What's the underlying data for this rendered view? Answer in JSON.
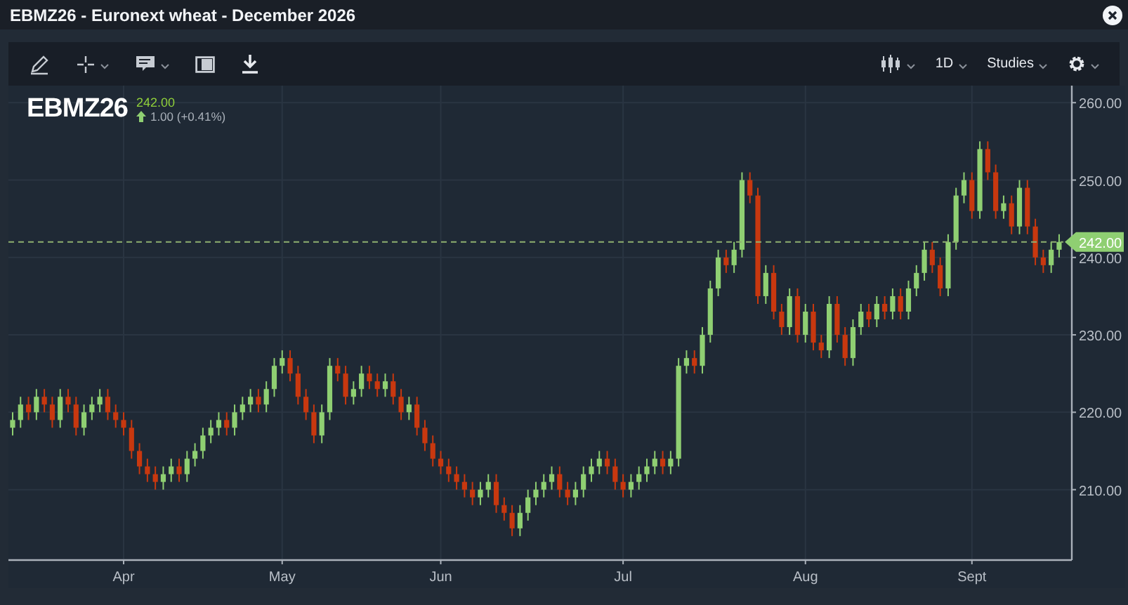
{
  "window": {
    "title": "EBMZ26 - Euronext wheat - December 2026"
  },
  "toolbar": {
    "interval": "1D",
    "studies": "Studies"
  },
  "quote": {
    "symbol": "EBMZ26",
    "price": "242.00",
    "change": "1.00 (+0.41%)"
  },
  "chart_data": {
    "type": "candlestick",
    "grid": true,
    "ylim": [
      200.9,
      262.2
    ],
    "yticks": [
      {
        "value": 210,
        "label": "210.00"
      },
      {
        "value": 220,
        "label": "220.00"
      },
      {
        "value": 230,
        "label": "230.00"
      },
      {
        "value": 240,
        "label": "240.00"
      },
      {
        "value": 250,
        "label": "250.00"
      },
      {
        "value": 260,
        "label": "260.00"
      }
    ],
    "ref_lines": [
      {
        "axis": "y",
        "value": 242,
        "label": "242.00",
        "color": "#8fb070"
      }
    ],
    "categories": [
      null,
      null,
      null,
      null,
      null,
      null,
      null,
      null,
      null,
      null,
      null,
      null,
      null,
      null,
      "Apr",
      null,
      null,
      null,
      null,
      null,
      null,
      null,
      null,
      null,
      null,
      null,
      null,
      null,
      null,
      null,
      null,
      null,
      null,
      null,
      "May",
      null,
      null,
      null,
      null,
      null,
      null,
      null,
      null,
      null,
      null,
      null,
      null,
      null,
      null,
      null,
      null,
      null,
      null,
      null,
      "Jun",
      null,
      null,
      null,
      null,
      null,
      null,
      null,
      null,
      null,
      null,
      null,
      null,
      null,
      null,
      null,
      null,
      null,
      null,
      null,
      null,
      null,
      null,
      "Jul",
      null,
      null,
      null,
      null,
      null,
      null,
      null,
      null,
      null,
      null,
      null,
      null,
      null,
      null,
      null,
      null,
      null,
      null,
      null,
      null,
      null,
      null,
      "Aug",
      null,
      null,
      null,
      null,
      null,
      null,
      null,
      null,
      null,
      null,
      null,
      null,
      null,
      null,
      null,
      null,
      null,
      null,
      null,
      null,
      "Sept",
      null,
      null,
      null,
      null,
      null,
      null,
      null,
      null,
      null,
      null,
      null
    ],
    "ohlc": [
      [
        218,
        220,
        217,
        219
      ],
      [
        219,
        222,
        218,
        221
      ],
      [
        221,
        222,
        219,
        220
      ],
      [
        220,
        223,
        219,
        222
      ],
      [
        222,
        223,
        220,
        221
      ],
      [
        221,
        222,
        218,
        219
      ],
      [
        219,
        223,
        218,
        222
      ],
      [
        222,
        223,
        220,
        221
      ],
      [
        221,
        222,
        217,
        218
      ],
      [
        218,
        221,
        217,
        220
      ],
      [
        220,
        222,
        219,
        221
      ],
      [
        221,
        223,
        220,
        222
      ],
      [
        222,
        223,
        219,
        220
      ],
      [
        220,
        221,
        218,
        219
      ],
      [
        219,
        220,
        217,
        218
      ],
      [
        218,
        219,
        214,
        215
      ],
      [
        215,
        216,
        212,
        213
      ],
      [
        213,
        214,
        211,
        212
      ],
      [
        212,
        213,
        210,
        211
      ],
      [
        211,
        213,
        210,
        212
      ],
      [
        212,
        214,
        211,
        213
      ],
      [
        213,
        214,
        211,
        212
      ],
      [
        212,
        215,
        211,
        214
      ],
      [
        214,
        216,
        213,
        215
      ],
      [
        215,
        218,
        214,
        217
      ],
      [
        217,
        219,
        216,
        218
      ],
      [
        218,
        220,
        217,
        219
      ],
      [
        219,
        220,
        217,
        218
      ],
      [
        218,
        221,
        217,
        220
      ],
      [
        220,
        222,
        219,
        221
      ],
      [
        221,
        223,
        220,
        222
      ],
      [
        222,
        223,
        220,
        221
      ],
      [
        221,
        224,
        220,
        223
      ],
      [
        223,
        227,
        222,
        226
      ],
      [
        226,
        228,
        225,
        227
      ],
      [
        227,
        228,
        224,
        225
      ],
      [
        225,
        226,
        221,
        222
      ],
      [
        222,
        223,
        219,
        220
      ],
      [
        220,
        221,
        216,
        217
      ],
      [
        217,
        221,
        216,
        220
      ],
      [
        220,
        227,
        219,
        226
      ],
      [
        226,
        227,
        224,
        225
      ],
      [
        225,
        226,
        221,
        222
      ],
      [
        222,
        224,
        221,
        223
      ],
      [
        223,
        226,
        222,
        225
      ],
      [
        225,
        226,
        223,
        224
      ],
      [
        224,
        225,
        222,
        223
      ],
      [
        223,
        225,
        222,
        224
      ],
      [
        224,
        225,
        221,
        222
      ],
      [
        222,
        223,
        219,
        220
      ],
      [
        220,
        222,
        219,
        221
      ],
      [
        221,
        222,
        217,
        218
      ],
      [
        218,
        219,
        215,
        216
      ],
      [
        216,
        217,
        213,
        214
      ],
      [
        214,
        215,
        212,
        213
      ],
      [
        213,
        214,
        211,
        212
      ],
      [
        212,
        213,
        210,
        211
      ],
      [
        211,
        212,
        209,
        210
      ],
      [
        210,
        211,
        208,
        209
      ],
      [
        209,
        211,
        208,
        210
      ],
      [
        210,
        212,
        209,
        211
      ],
      [
        211,
        212,
        207,
        208
      ],
      [
        208,
        209,
        206,
        207
      ],
      [
        207,
        208,
        204,
        205
      ],
      [
        205,
        208,
        204,
        207
      ],
      [
        207,
        210,
        206,
        209
      ],
      [
        209,
        211,
        208,
        210
      ],
      [
        210,
        212,
        209,
        211
      ],
      [
        211,
        213,
        210,
        212
      ],
      [
        212,
        213,
        209,
        210
      ],
      [
        210,
        211,
        208,
        209
      ],
      [
        209,
        211,
        208,
        210
      ],
      [
        210,
        213,
        209,
        212
      ],
      [
        212,
        214,
        211,
        213
      ],
      [
        213,
        215,
        212,
        214
      ],
      [
        214,
        215,
        212,
        213
      ],
      [
        213,
        214,
        210,
        211
      ],
      [
        211,
        212,
        209,
        210
      ],
      [
        210,
        212,
        209,
        211
      ],
      [
        211,
        213,
        210,
        212
      ],
      [
        212,
        214,
        211,
        213
      ],
      [
        213,
        215,
        212,
        214
      ],
      [
        214,
        215,
        212,
        213
      ],
      [
        213,
        215,
        212,
        214
      ],
      [
        214,
        227,
        213,
        226
      ],
      [
        226,
        228,
        225,
        227
      ],
      [
        227,
        228,
        225,
        226
      ],
      [
        226,
        231,
        225,
        230
      ],
      [
        230,
        237,
        229,
        236
      ],
      [
        236,
        241,
        235,
        240
      ],
      [
        240,
        241,
        238,
        239
      ],
      [
        239,
        242,
        238,
        241
      ],
      [
        241,
        251,
        240,
        250
      ],
      [
        250,
        251,
        247,
        248
      ],
      [
        248,
        249,
        234,
        235
      ],
      [
        235,
        239,
        234,
        238
      ],
      [
        238,
        239,
        232,
        233
      ],
      [
        233,
        234,
        230,
        231
      ],
      [
        231,
        236,
        230,
        235
      ],
      [
        235,
        236,
        229,
        230
      ],
      [
        230,
        234,
        229,
        233
      ],
      [
        233,
        234,
        228,
        229
      ],
      [
        229,
        230,
        227,
        228
      ],
      [
        228,
        235,
        227,
        234
      ],
      [
        234,
        235,
        229,
        230
      ],
      [
        230,
        231,
        226,
        227
      ],
      [
        227,
        232,
        226,
        231
      ],
      [
        231,
        234,
        230,
        233
      ],
      [
        233,
        234,
        231,
        232
      ],
      [
        232,
        235,
        231,
        234
      ],
      [
        234,
        235,
        232,
        233
      ],
      [
        233,
        236,
        232,
        235
      ],
      [
        235,
        236,
        232,
        233
      ],
      [
        233,
        237,
        232,
        236
      ],
      [
        236,
        239,
        235,
        238
      ],
      [
        238,
        242,
        237,
        241
      ],
      [
        241,
        242,
        238,
        239
      ],
      [
        239,
        240,
        235,
        236
      ],
      [
        236,
        243,
        235,
        242
      ],
      [
        242,
        249,
        241,
        248
      ],
      [
        248,
        251,
        247,
        250
      ],
      [
        250,
        251,
        245,
        246
      ],
      [
        246,
        255,
        245,
        254
      ],
      [
        254,
        255,
        250,
        251
      ],
      [
        251,
        252,
        245,
        246
      ],
      [
        246,
        248,
        245,
        247
      ],
      [
        247,
        248,
        243,
        244
      ],
      [
        244,
        250,
        243,
        249
      ],
      [
        249,
        250,
        243,
        244
      ],
      [
        244,
        245,
        239,
        240
      ],
      [
        240,
        241,
        238,
        239
      ],
      [
        239,
        242,
        238,
        241
      ],
      [
        241,
        243,
        240,
        242
      ]
    ]
  }
}
